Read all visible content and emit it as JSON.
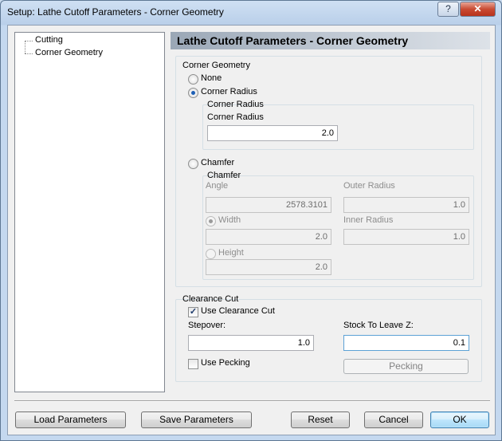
{
  "window": {
    "title": "Setup: Lathe Cutoff Parameters - Corner Geometry",
    "help_label": "?",
    "close_label": "✕"
  },
  "tree": {
    "items": [
      {
        "label": "Cutting"
      },
      {
        "label": "Corner Geometry"
      }
    ]
  },
  "header": {
    "title": "Lathe Cutoff Parameters - Corner Geometry"
  },
  "corner_geometry": {
    "group_label": "Corner Geometry",
    "options": {
      "none": "None",
      "corner_radius": "Corner Radius",
      "chamfer": "Chamfer"
    },
    "selected": "corner_radius",
    "corner_radius": {
      "group_label": "Corner Radius",
      "field_label": "Corner Radius",
      "value": "2.0"
    },
    "chamfer": {
      "group_label": "Chamfer",
      "angle_label": "Angle",
      "angle_value": "2578.3101",
      "outer_radius_label": "Outer Radius",
      "outer_radius_value": "1.0",
      "width_label": "Width",
      "width_value": "2.0",
      "inner_radius_label": "Inner Radius",
      "inner_radius_value": "1.0",
      "height_label": "Height",
      "height_value": "2.0",
      "mode_selected": "width"
    }
  },
  "clearance_cut": {
    "group_label": "Clearance Cut",
    "use_clearance_label": "Use Clearance Cut",
    "use_clearance_checked": true,
    "stepover_label": "Stepover:",
    "stepover_value": "1.0",
    "stock_label": "Stock To Leave Z:",
    "stock_value": "0.1",
    "use_pecking_label": "Use Pecking",
    "use_pecking_checked": false,
    "pecking_button": "Pecking"
  },
  "footer": {
    "load": "Load Parameters",
    "save": "Save Parameters",
    "reset": "Reset",
    "cancel": "Cancel",
    "ok": "OK"
  },
  "colors": {
    "accent": "#1d5fb5",
    "header_gradient_start": "#9aa7b6"
  }
}
